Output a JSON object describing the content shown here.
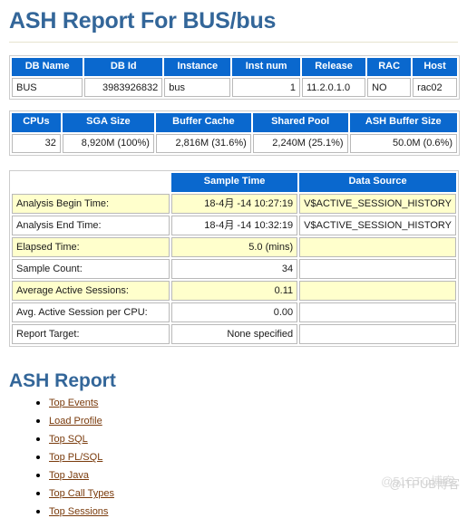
{
  "page": {
    "title": "ASH Report For BUS/bus",
    "section_title": "ASH Report"
  },
  "db_summary": {
    "headers": [
      "DB Name",
      "DB Id",
      "Instance",
      "Inst num",
      "Release",
      "RAC",
      "Host"
    ],
    "row": {
      "db_name": "BUS",
      "db_id": "3983926832",
      "instance": "bus",
      "inst_num": "1",
      "release": "11.2.0.1.0",
      "rac": "NO",
      "host": "rac02"
    }
  },
  "sizing": {
    "headers": [
      "CPUs",
      "SGA Size",
      "Buffer Cache",
      "Shared Pool",
      "ASH Buffer Size"
    ],
    "row": {
      "cpus": "32",
      "sga_size": "8,920M (100%)",
      "buffer_cache": "2,816M (31.6%)",
      "shared_pool": "2,240M (25.1%)",
      "ash_buffer_size": "50.0M (0.6%)"
    }
  },
  "analysis": {
    "headers": [
      "",
      "Sample Time",
      "Data Source"
    ],
    "rows": [
      {
        "label": "Analysis Begin Time:",
        "value": "18-4月 -14 10:27:19",
        "source": "V$ACTIVE_SESSION_HISTORY"
      },
      {
        "label": "Analysis End Time:",
        "value": "18-4月 -14 10:32:19",
        "source": "V$ACTIVE_SESSION_HISTORY"
      },
      {
        "label": "Elapsed Time:",
        "value": "5.0 (mins)",
        "source": ""
      },
      {
        "label": "Sample Count:",
        "value": "34",
        "source": ""
      },
      {
        "label": "Average Active Sessions:",
        "value": "0.11",
        "source": ""
      },
      {
        "label": "Avg. Active Session per CPU:",
        "value": "0.00",
        "source": ""
      },
      {
        "label": "Report Target:",
        "value": "None specified",
        "source": ""
      }
    ]
  },
  "toc": {
    "items": [
      {
        "label": "Top Events"
      },
      {
        "label": "Load Profile"
      },
      {
        "label": "Top SQL"
      },
      {
        "label": "Top PL/SQL"
      },
      {
        "label": "Top Java"
      },
      {
        "label": "Top Call Types"
      },
      {
        "label": "Top Sessions"
      }
    ]
  },
  "watermarks": {
    "primary": "@51CTO博客",
    "secondary": "@ITPUB博客"
  },
  "colors": {
    "header_blue": "#0A68CE",
    "title_blue": "#336699",
    "alt_row_yellow": "#FFFFCC",
    "link_brown": "#7A3B0C"
  }
}
